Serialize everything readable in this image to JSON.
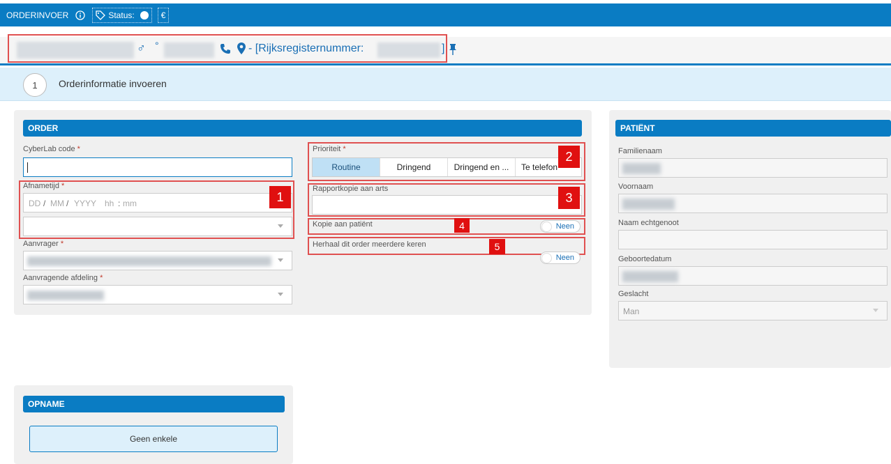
{
  "topbar": {
    "title": "ORDERINVOER",
    "info_icon": "info-circle-icon",
    "tag_icon": "tag-icon",
    "status_label": "Status:",
    "currency_label": "€"
  },
  "patient_header": {
    "gender_symbol": "♂",
    "degree_symbol": "°",
    "register_label": "- [Rijksregisternummer:",
    "register_close": "]"
  },
  "wizard": {
    "step_number": "1",
    "step_label": "Orderinformatie invoeren"
  },
  "order": {
    "title": "ORDER",
    "cyberlab_label": "CyberLab code",
    "afnametijd_label": "Afnametijd",
    "date_dd": "DD",
    "date_mm": "MM",
    "date_yyyy": "YYYY",
    "time_hh": "hh",
    "time_mm": "mm",
    "aanvrager_label": "Aanvrager",
    "afdeling_label": "Aanvragende afdeling",
    "prioriteit_label": "Prioriteit",
    "priority_options": [
      "Routine",
      "Dringend",
      "Dringend en ...",
      "Te telefon"
    ],
    "priority_selected": "Routine",
    "rapport_label": "Rapportkopie aan arts",
    "kopie_label": "Kopie aan patiënt",
    "kopie_value": "Neen",
    "herhaal_label": "Herhaal dit order meerdere keren",
    "herhaal_value": "Neen",
    "required_mark": "*"
  },
  "annotations": [
    "1",
    "2",
    "3",
    "4",
    "5"
  ],
  "patient": {
    "title": "PATIËNT",
    "familienaam_label": "Familienaam",
    "voornaam_label": "Voornaam",
    "echtgenoot_label": "Naam echtgenoot",
    "geboortedatum_label": "Geboortedatum",
    "geslacht_label": "Geslacht",
    "geslacht_value": "Man"
  },
  "opname": {
    "title": "OPNAME",
    "button_label": "Geen enkele"
  },
  "colors": {
    "primary": "#0a7cc3",
    "annotation_red": "#e01010",
    "step_bg": "#ddf0fb"
  }
}
